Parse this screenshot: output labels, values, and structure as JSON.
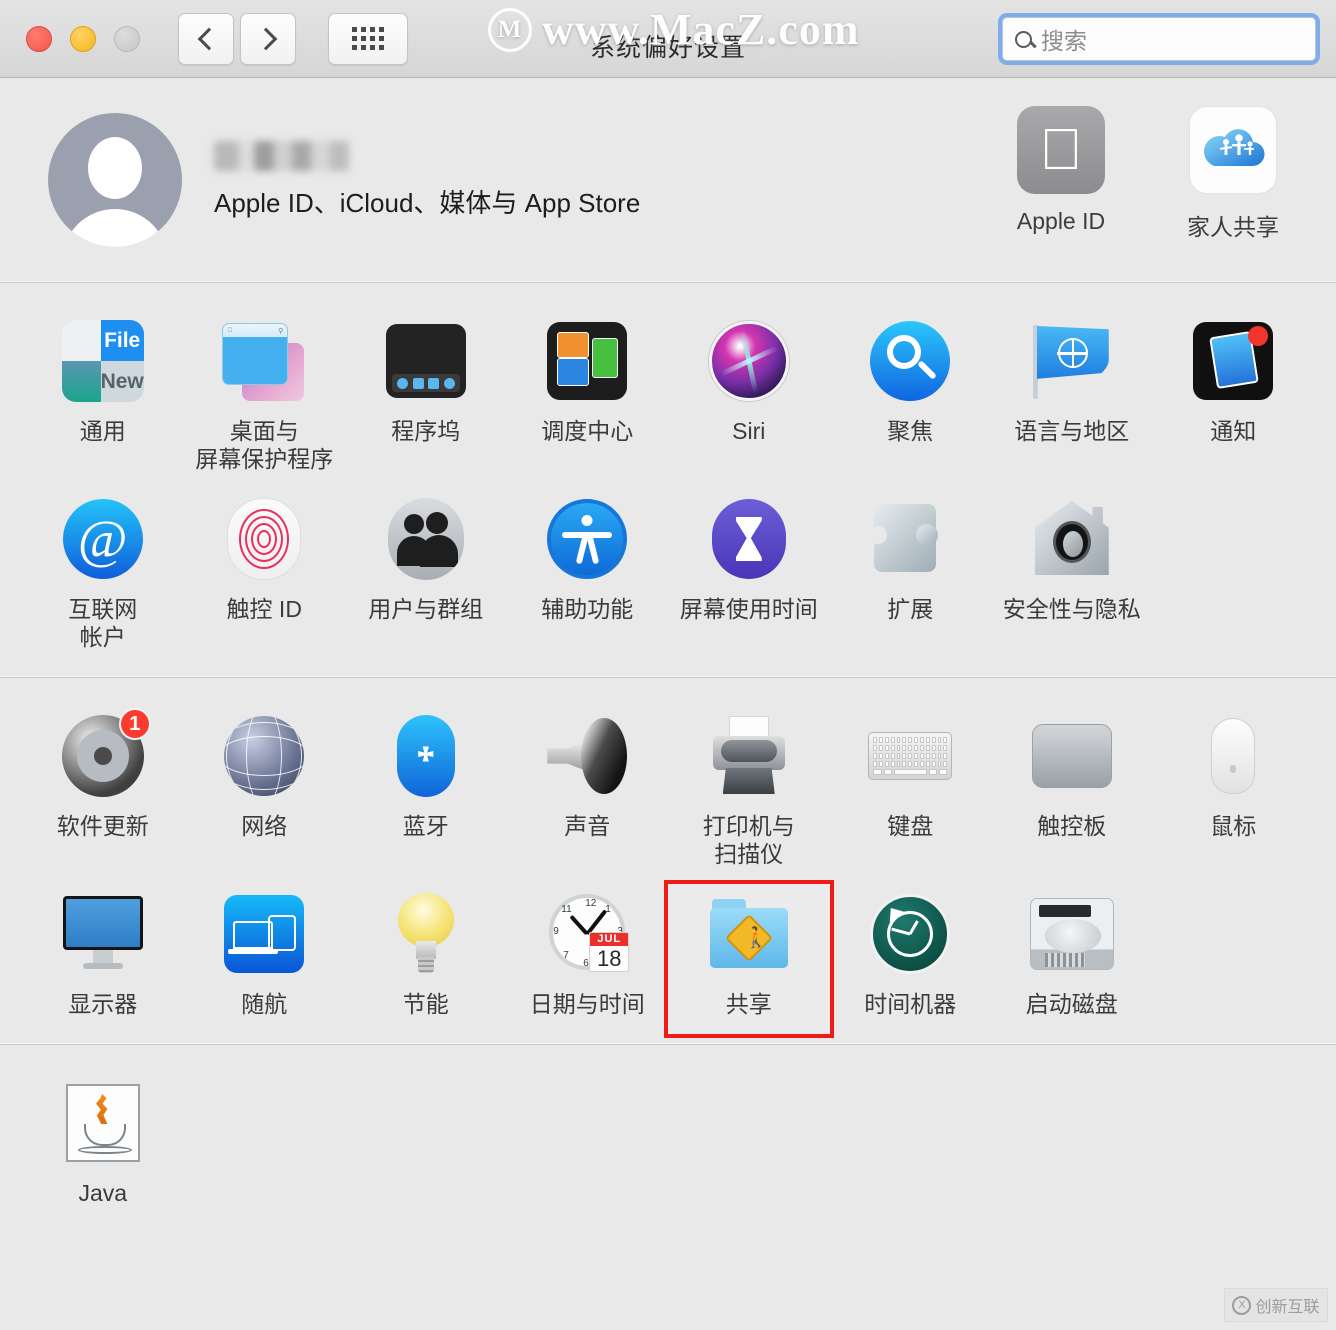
{
  "window": {
    "title": "系统偏好设置",
    "traffic_lights": [
      "close",
      "minimize",
      "zoom"
    ],
    "nav": {
      "back": "back-button",
      "forward": "forward-button",
      "grid": "show-all-button"
    }
  },
  "watermarks": {
    "top": "www.MacZ.com",
    "top_mark": "M",
    "bottom": "创新互联",
    "bottom_mark": "X"
  },
  "search": {
    "placeholder": "搜索",
    "value": "",
    "icon": "search-icon"
  },
  "account": {
    "name": "",
    "subtitle": "Apple ID、iCloud、媒体与 App Store",
    "avatar": "user-avatar-icon",
    "tiles": [
      {
        "label": "Apple ID",
        "icon": "apple-logo-icon"
      },
      {
        "label": "家人共享",
        "icon": "family-sharing-icon"
      }
    ]
  },
  "sections": [
    {
      "name": "personal",
      "items": [
        {
          "label": "通用",
          "icon": "general-icon",
          "badge": null,
          "selected": false
        },
        {
          "label": "桌面与\n屏幕保护程序",
          "icon": "desktop-screensaver-icon",
          "badge": null,
          "selected": false
        },
        {
          "label": "程序坞",
          "icon": "dock-icon",
          "badge": null,
          "selected": false
        },
        {
          "label": "调度中心",
          "icon": "mission-control-icon",
          "badge": null,
          "selected": false
        },
        {
          "label": "Siri",
          "icon": "siri-icon",
          "badge": null,
          "selected": false
        },
        {
          "label": "聚焦",
          "icon": "spotlight-icon",
          "badge": null,
          "selected": false
        },
        {
          "label": "语言与地区",
          "icon": "language-region-icon",
          "badge": null,
          "selected": false
        },
        {
          "label": "通知",
          "icon": "notifications-icon",
          "badge": null,
          "selected": false
        },
        {
          "label": "互联网\n帐户",
          "icon": "internet-accounts-icon",
          "badge": null,
          "selected": false
        },
        {
          "label": "触控 ID",
          "icon": "touch-id-icon",
          "badge": null,
          "selected": false
        },
        {
          "label": "用户与群组",
          "icon": "users-groups-icon",
          "badge": null,
          "selected": false
        },
        {
          "label": "辅助功能",
          "icon": "accessibility-icon",
          "badge": null,
          "selected": false
        },
        {
          "label": "屏幕使用时间",
          "icon": "screen-time-icon",
          "badge": null,
          "selected": false
        },
        {
          "label": "扩展",
          "icon": "extensions-icon",
          "badge": null,
          "selected": false
        },
        {
          "label": "安全性与隐私",
          "icon": "security-privacy-icon",
          "badge": null,
          "selected": false
        }
      ]
    },
    {
      "name": "hardware",
      "items": [
        {
          "label": "软件更新",
          "icon": "software-update-icon",
          "badge": "1",
          "selected": false
        },
        {
          "label": "网络",
          "icon": "network-icon",
          "badge": null,
          "selected": false
        },
        {
          "label": "蓝牙",
          "icon": "bluetooth-icon",
          "badge": null,
          "selected": false
        },
        {
          "label": "声音",
          "icon": "sound-icon",
          "badge": null,
          "selected": false
        },
        {
          "label": "打印机与\n扫描仪",
          "icon": "printers-scanners-icon",
          "badge": null,
          "selected": false
        },
        {
          "label": "键盘",
          "icon": "keyboard-icon",
          "badge": null,
          "selected": false
        },
        {
          "label": "触控板",
          "icon": "trackpad-icon",
          "badge": null,
          "selected": false
        },
        {
          "label": "鼠标",
          "icon": "mouse-icon",
          "badge": null,
          "selected": false
        },
        {
          "label": "显示器",
          "icon": "displays-icon",
          "badge": null,
          "selected": false
        },
        {
          "label": "随航",
          "icon": "sidecar-icon",
          "badge": null,
          "selected": false
        },
        {
          "label": "节能",
          "icon": "energy-saver-icon",
          "badge": null,
          "selected": false
        },
        {
          "label": "日期与时间",
          "icon": "date-time-icon",
          "badge": null,
          "selected": false
        },
        {
          "label": "共享",
          "icon": "sharing-icon",
          "badge": null,
          "selected": true
        },
        {
          "label": "时间机器",
          "icon": "time-machine-icon",
          "badge": null,
          "selected": false
        },
        {
          "label": "启动磁盘",
          "icon": "startup-disk-icon",
          "badge": null,
          "selected": false
        }
      ]
    },
    {
      "name": "other",
      "items": [
        {
          "label": "Java",
          "icon": "java-icon",
          "badge": null,
          "selected": false
        }
      ]
    }
  ],
  "date_icon": {
    "month": "JUL",
    "day": "18"
  },
  "colors": {
    "selection_outline": "#ee1b17",
    "badge": "#fc3b30",
    "window_bg": "#e9e9e9",
    "titlebar_bg": "#dcdcdc",
    "focus_ring": "#7fadea"
  }
}
